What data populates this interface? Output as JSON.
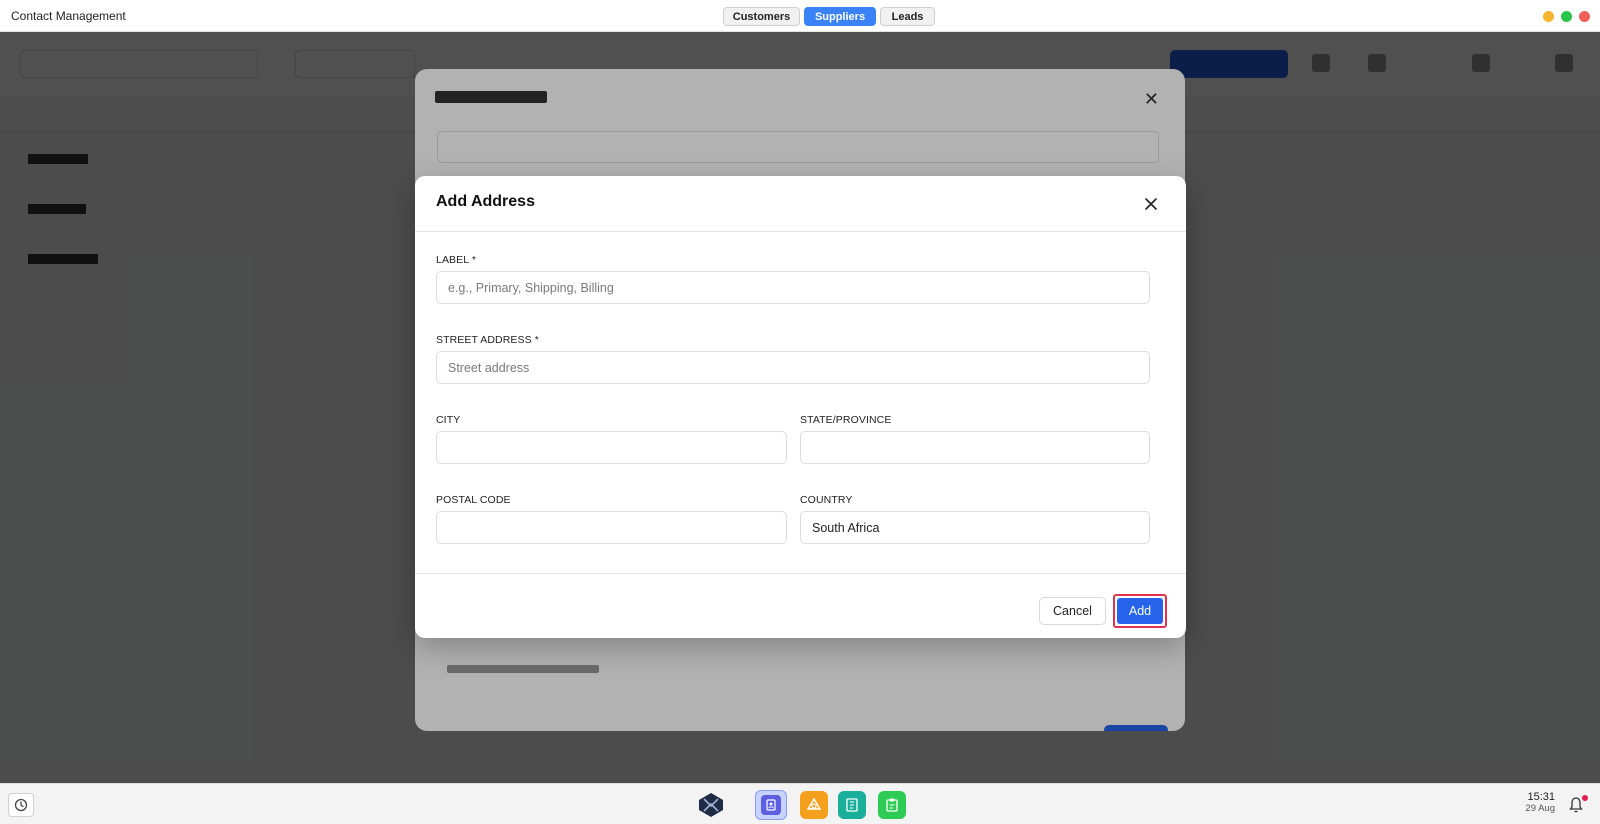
{
  "window": {
    "title": "Contact Management",
    "tabs": [
      {
        "label": "Customers",
        "active": false
      },
      {
        "label": "Suppliers",
        "active": true
      },
      {
        "label": "Leads",
        "active": false
      }
    ],
    "controls": [
      "minimize",
      "maximize",
      "close"
    ]
  },
  "colors": {
    "accent": "#2563eb",
    "tab_active": "#3b82f6",
    "highlight_border": "#e0334f",
    "overlay": "rgba(0,0,0,0.55)"
  },
  "add_address_modal": {
    "title": "Add Address",
    "close_icon": "close-icon",
    "fields": {
      "label": {
        "label": "LABEL *",
        "placeholder": "e.g., Primary, Shipping, Billing",
        "value": ""
      },
      "street": {
        "label": "STREET ADDRESS *",
        "placeholder": "Street address",
        "value": ""
      },
      "city": {
        "label": "CITY",
        "placeholder": "",
        "value": ""
      },
      "state": {
        "label": "STATE/PROVINCE",
        "placeholder": "",
        "value": ""
      },
      "postal": {
        "label": "POSTAL CODE",
        "placeholder": "",
        "value": ""
      },
      "country": {
        "label": "COUNTRY",
        "placeholder": "",
        "value": "South Africa"
      }
    },
    "cancel_label": "Cancel",
    "add_label": "Add"
  },
  "taskbar": {
    "time": "15:31",
    "date": "29 Aug",
    "apps": [
      "launcher-icon",
      "contacts-icon",
      "layers-icon",
      "sheet-icon",
      "notes-icon"
    ],
    "notification_icon": "bell-icon"
  }
}
